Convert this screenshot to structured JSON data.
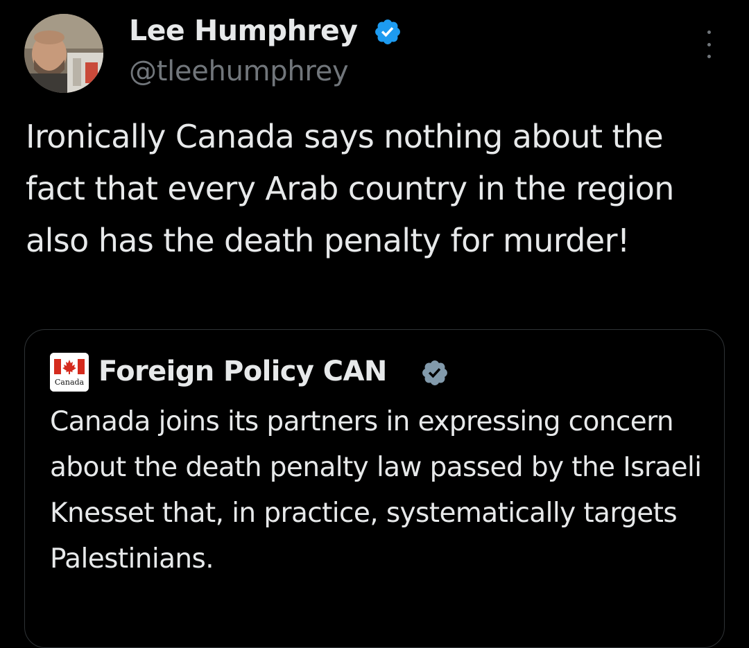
{
  "tweet": {
    "author_name": "Lee Humphrey",
    "author_handle": "@tleehumphrey",
    "text": "Ironically Canada says nothing about the fact that every Arab country in the region also has the death penalty for murder!"
  },
  "quoted_tweet": {
    "author_name": "Foreign Policy CAN",
    "avatar_text": "Canada",
    "text": "Canada joins its partners in expressing concern about the death penalty law passed by the Israeli Knesset that, in practice, systematically targets Palestinians."
  },
  "colors": {
    "background": "#000000",
    "primary_text": "#e7e9ea",
    "secondary_text": "#71767b",
    "verified_blue": "#1d9bf0",
    "verified_gray": "#829aab",
    "card_border": "#2f3336",
    "canada_red": "#d52b1e"
  },
  "icons": {
    "main_verified": "verified-badge-blue-icon",
    "quote_verified": "verified-badge-gray-icon",
    "more": "more-options-icon"
  }
}
